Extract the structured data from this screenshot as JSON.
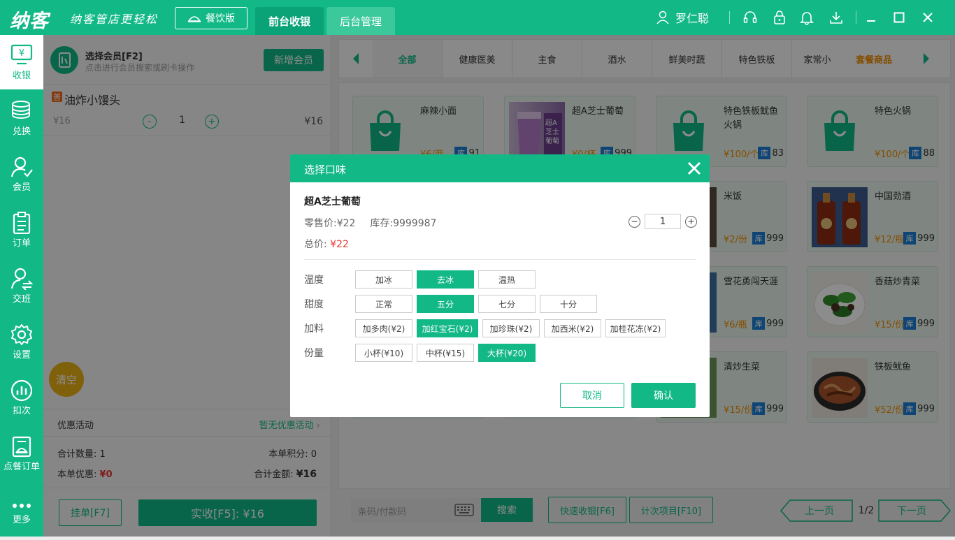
{
  "app": {
    "logo": "纳客",
    "slogan": "纳客管店更轻松",
    "edition": "餐饮版",
    "tabs": [
      "前台收银",
      "后台管理"
    ],
    "user": "罗仁聪"
  },
  "nav": [
    "收银",
    "兑换",
    "会员",
    "订单",
    "交班",
    "设置",
    "扣次",
    "点餐订单",
    "更多"
  ],
  "member": {
    "title": "选择会员[F2]",
    "subtitle": "点击进行会员搜索或刷卡操作",
    "add": "新增会员"
  },
  "cart": [
    {
      "badge": "普",
      "name": "油炸小馒头",
      "price": "¥16",
      "qty": "1",
      "subtotal": "¥16"
    }
  ],
  "clear": "清空",
  "promo": {
    "label": "优惠活动",
    "value": "暂无优惠活动"
  },
  "summary": {
    "qty_label": "合计数量:",
    "qty": "1",
    "points_label": "本单积分:",
    "points": "0",
    "discount_label": "本单优惠:",
    "discount": "¥0",
    "total_label": "合计金额:",
    "total": "¥16"
  },
  "actions": {
    "hang": "挂单[F7]",
    "pay": "实收[F5]: ¥16"
  },
  "categories": [
    "全部",
    "健康医美",
    "主食",
    "酒水",
    "鲜美时蔬",
    "特色铁板",
    "家常小",
    "套餐商品"
  ],
  "products": [
    {
      "name": "麻辣小面",
      "price": "¥6/两",
      "stock": "91"
    },
    {
      "name": "超A芝士葡萄",
      "price": "¥0/杯",
      "stock": "999"
    },
    {
      "name": "特色铁板鱿鱼火锅",
      "price": "¥100/个",
      "stock": "83"
    },
    {
      "name": "特色火锅",
      "price": "¥100/个",
      "stock": "88"
    },
    {
      "name": "米饭",
      "price": "¥2/份",
      "stock": "999"
    },
    {
      "name": "中国劲酒",
      "price": "¥12/瓶",
      "stock": "999"
    },
    {
      "name": "雪花勇闯天涯",
      "price": "¥6/瓶",
      "stock": "999"
    },
    {
      "name": "香菇炒青菜",
      "price": "¥15/份",
      "stock": "999"
    },
    {
      "name": "清炒生菜",
      "price": "¥15/份",
      "stock": "999"
    },
    {
      "name": "铁板鱿鱼",
      "price": "¥52/份",
      "stock": "999"
    }
  ],
  "stock_label": "库",
  "product_image_text": "超A芝士葡萄",
  "bottom": {
    "search_placeholder": "条码/付款码",
    "search": "搜索",
    "quick": "快速收银[F6]",
    "count": "计次项目[F10]",
    "prev": "上一页",
    "page": "1/2",
    "next": "下一页"
  },
  "modal": {
    "title": "选择口味",
    "product": "超A芝士葡萄",
    "price_label": "零售价:",
    "price": "¥22",
    "stock_label": "库存:",
    "stock": "9999987",
    "total_label": "总价:",
    "total": "¥22",
    "qty": "1",
    "groups": [
      {
        "label": "温度",
        "options": [
          "加冰",
          "去冰",
          "温热"
        ],
        "selected": 1
      },
      {
        "label": "甜度",
        "options": [
          "正常",
          "五分",
          "七分",
          "十分"
        ],
        "selected": 1
      },
      {
        "label": "加料",
        "options": [
          "加多肉(¥2)",
          "加红宝石(¥2)",
          "加珍珠(¥2)",
          "加西米(¥2)",
          "加桂花冻(¥2)"
        ],
        "selected": 1
      },
      {
        "label": "份量",
        "options": [
          "小杯(¥10)",
          "中杯(¥15)",
          "大杯(¥20)"
        ],
        "selected": 2
      }
    ],
    "cancel": "取消",
    "confirm": "确认"
  }
}
